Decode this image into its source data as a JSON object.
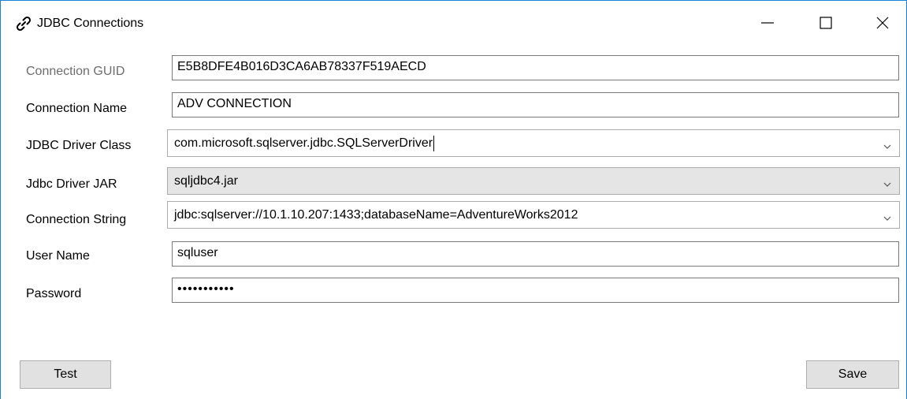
{
  "window": {
    "title": "JDBC Connections"
  },
  "form": {
    "connection_guid": {
      "label": "Connection GUID",
      "value": "E5B8DFE4B016D3CA6AB78337F519AECD"
    },
    "connection_name": {
      "label": "Connection Name",
      "value": "ADV CONNECTION"
    },
    "driver_class": {
      "label": "JDBC Driver Class",
      "value": "com.microsoft.sqlserver.jdbc.SQLServerDriver"
    },
    "driver_jar": {
      "label": "Jdbc Driver JAR",
      "value": "sqljdbc4.jar"
    },
    "connection_string": {
      "label": "Connection String",
      "value": "jdbc:sqlserver://10.1.10.207:1433;databaseName=AdventureWorks2012"
    },
    "user_name": {
      "label": "User Name",
      "value": "sqluser"
    },
    "password": {
      "label": "Password",
      "value": "•••••••••••"
    }
  },
  "buttons": {
    "test_label": "Test",
    "save_label": "Save"
  },
  "icons": {
    "app": "link-icon",
    "minimize": "minimize-icon",
    "maximize": "maximize-icon",
    "close": "close-icon",
    "dropdown": "chevron-down-icon"
  },
  "colors": {
    "window_border": "#1883d7",
    "readonly_combo_bg": "#e5e5e5",
    "button_bg": "#e1e1e1",
    "muted_label": "#6d6d6d"
  }
}
